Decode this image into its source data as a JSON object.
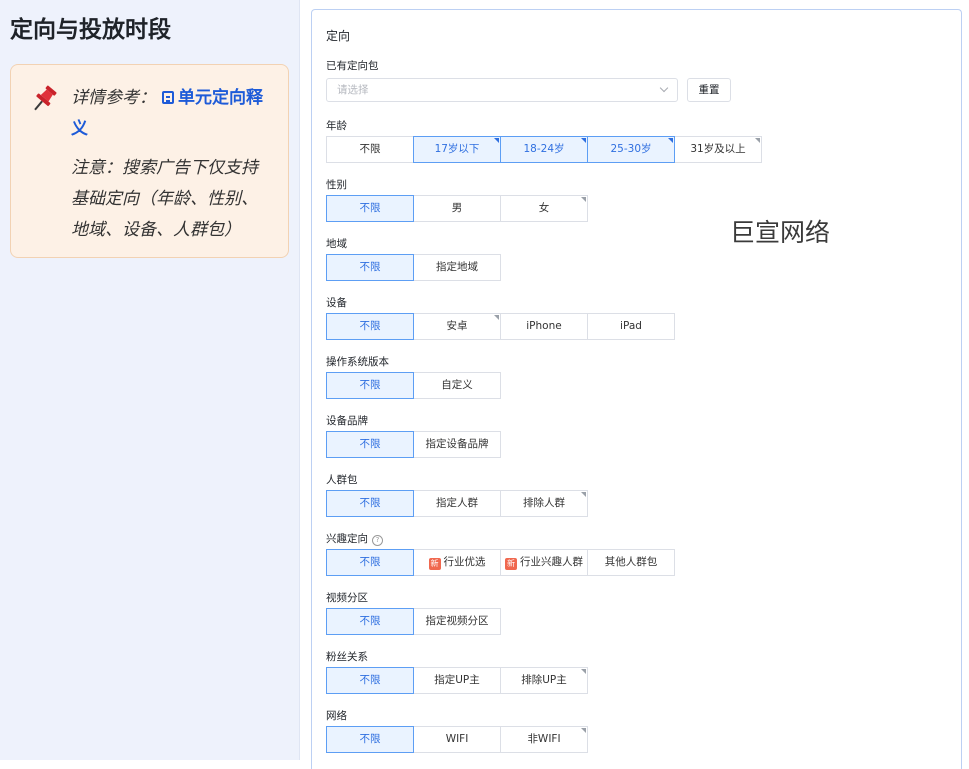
{
  "sidebar": {
    "title": "定向与投放时段",
    "notice": {
      "ref_prefix": "详情参考：",
      "ref_link": "单元定向释义",
      "note": "注意：搜索广告下仅支持基础定向（年龄、性别、地域、设备、人群包）"
    }
  },
  "panel": {
    "title": "定向",
    "package": {
      "label": "已有定向包",
      "placeholder": "请选择",
      "reset": "重置"
    },
    "groups": [
      {
        "label": "年龄",
        "options": [
          {
            "text": "不限",
            "active": false
          },
          {
            "text": "17岁以下",
            "active": true,
            "corner": true
          },
          {
            "text": "18-24岁",
            "active": true,
            "corner": true
          },
          {
            "text": "25-30岁",
            "active": true,
            "corner": true
          },
          {
            "text": "31岁及以上",
            "active": false,
            "corner_gray": true
          }
        ]
      },
      {
        "label": "性别",
        "options": [
          {
            "text": "不限",
            "active": true
          },
          {
            "text": "男",
            "active": false
          },
          {
            "text": "女",
            "active": false,
            "corner_gray": true
          }
        ]
      },
      {
        "label": "地域",
        "options": [
          {
            "text": "不限",
            "active": true
          },
          {
            "text": "指定地域",
            "active": false
          }
        ]
      },
      {
        "label": "设备",
        "options": [
          {
            "text": "不限",
            "active": true
          },
          {
            "text": "安卓",
            "active": false,
            "corner_gray": true
          },
          {
            "text": "iPhone",
            "active": false
          },
          {
            "text": "iPad",
            "active": false
          }
        ]
      },
      {
        "label": "操作系统版本",
        "options": [
          {
            "text": "不限",
            "active": true
          },
          {
            "text": "自定义",
            "active": false
          }
        ]
      },
      {
        "label": "设备品牌",
        "options": [
          {
            "text": "不限",
            "active": true
          },
          {
            "text": "指定设备品牌",
            "active": false
          }
        ]
      },
      {
        "label": "人群包",
        "options": [
          {
            "text": "不限",
            "active": true
          },
          {
            "text": "指定人群",
            "active": false
          },
          {
            "text": "排除人群",
            "active": false,
            "corner_gray": true
          }
        ]
      },
      {
        "label": "兴趣定向",
        "help": "?",
        "options": [
          {
            "text": "不限",
            "active": true
          },
          {
            "text": "行业优选",
            "active": false,
            "badge": "新"
          },
          {
            "text": "行业兴趣人群",
            "active": false,
            "badge": "新"
          },
          {
            "text": "其他人群包",
            "active": false
          }
        ]
      },
      {
        "label": "视频分区",
        "options": [
          {
            "text": "不限",
            "active": true
          },
          {
            "text": "指定视频分区",
            "active": false
          }
        ]
      },
      {
        "label": "粉丝关系",
        "options": [
          {
            "text": "不限",
            "active": true
          },
          {
            "text": "指定UP主",
            "active": false
          },
          {
            "text": "排除UP主",
            "active": false,
            "corner_gray": true
          }
        ]
      },
      {
        "label": "网络",
        "options": [
          {
            "text": "不限",
            "active": true
          },
          {
            "text": "WIFI",
            "active": false
          },
          {
            "text": "非WIFI",
            "active": false,
            "corner_gray": true
          }
        ]
      }
    ]
  },
  "watermark": {
    "brand": "巨宣网络"
  },
  "colors": {
    "accent": "#2f6fe0",
    "active_bg": "#eaf3ff",
    "notice_bg": "#fdf1e6",
    "sidebar_bg": "#eef2fc"
  }
}
